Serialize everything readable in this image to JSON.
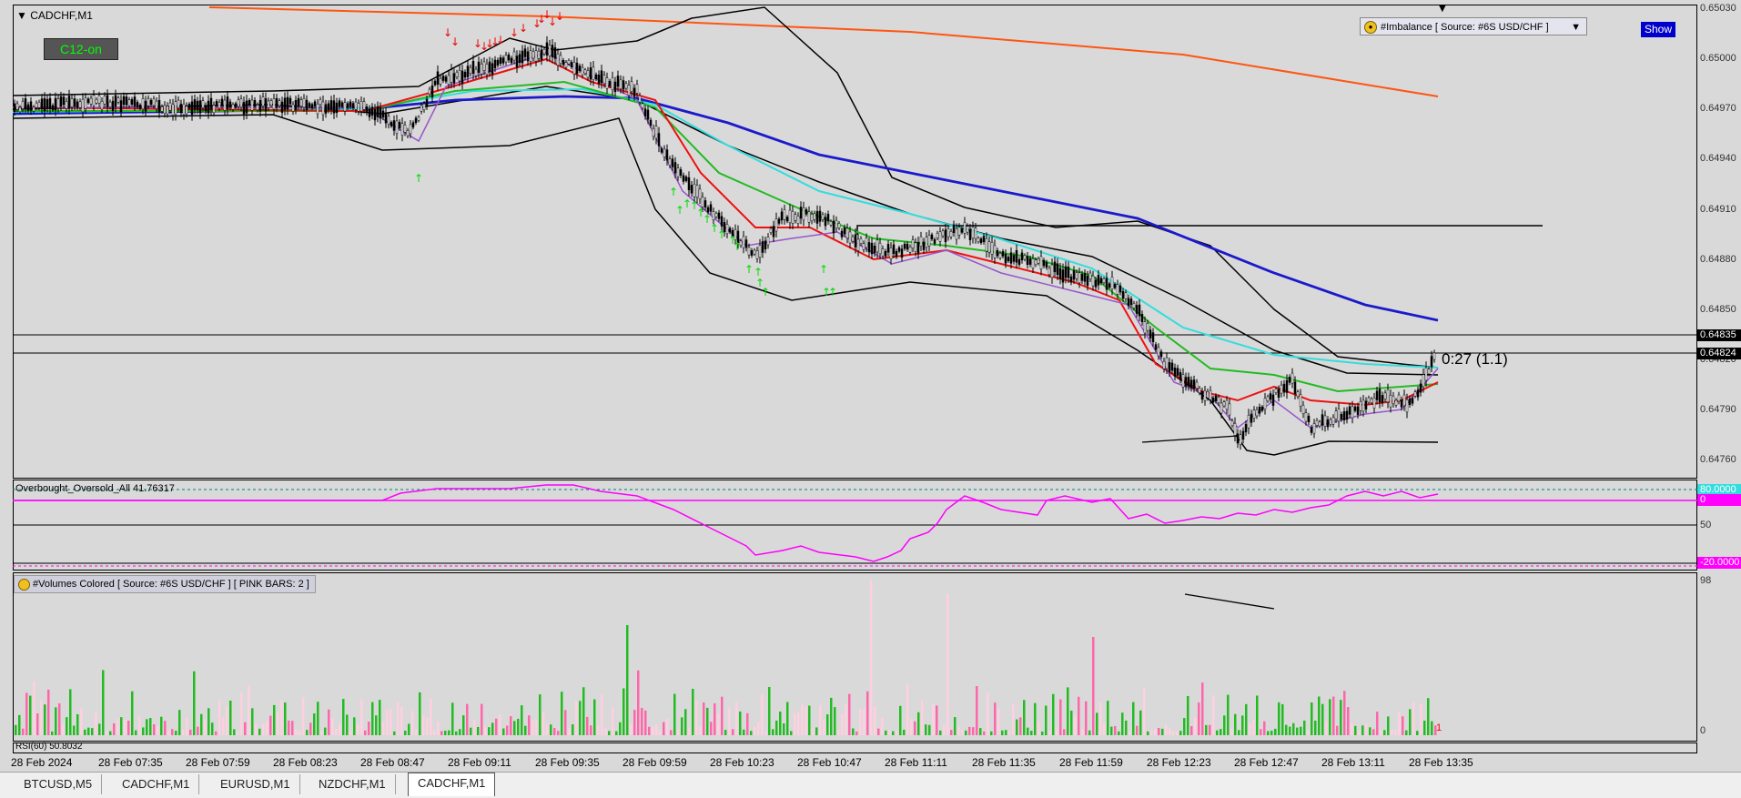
{
  "chart": {
    "title": "CADCHF,M1",
    "c12_label": "C12-on",
    "imbalance_label": "#Imbalance [ Source: #6S USD/CHF ]",
    "show_button": "Show",
    "timer_text": "0:27 (1.1)",
    "oscillator_label": "Overbought_Oversold_All 41.76317",
    "volumes_label": "#Volumes Colored [ Source: #6S USD/CHF ]  [ PINK BARS: 2 ]",
    "rsi_label": "RSI(60) 50.8032",
    "volume_last_count": "1"
  },
  "price_scale": {
    "labels": [
      "0.65030",
      "0.65000",
      "0.64970",
      "0.64940",
      "0.64910",
      "0.64880",
      "0.64850",
      "0.64820",
      "0.64790",
      "0.64760"
    ],
    "tag_upper": "0.64835",
    "tag_lower": "0.64824"
  },
  "osc_scale": {
    "top": "80.0000",
    "pink": "0",
    "mid": "50",
    "bottom": "-20.0000"
  },
  "vol_scale": {
    "top": "98",
    "bottom": "0"
  },
  "time_axis": [
    "28 Feb 2024",
    "28 Feb 07:35",
    "28 Feb 07:59",
    "28 Feb 08:23",
    "28 Feb 08:47",
    "28 Feb 09:11",
    "28 Feb 09:35",
    "28 Feb 09:59",
    "28 Feb 10:23",
    "28 Feb 10:47",
    "28 Feb 11:11",
    "28 Feb 11:35",
    "28 Feb 11:59",
    "28 Feb 12:23",
    "28 Feb 12:47",
    "28 Feb 13:11",
    "28 Feb 13:35"
  ],
  "tabs": [
    {
      "label": "BTCUSD,M5",
      "active": false
    },
    {
      "label": "CADCHF,M1",
      "active": false
    },
    {
      "label": "EURUSD,M1",
      "active": false
    },
    {
      "label": "NZDCHF,M1",
      "active": false
    },
    {
      "label": "CADCHF,M1",
      "active": true
    }
  ],
  "colors": {
    "bull_volume": "#22bb22",
    "bear_volume": "#ffd0e0",
    "pink_volume": "#ff66aa",
    "oscillator": "#ff00ff",
    "ma_blue": "#1a1acc",
    "ma_cyan": "#33dddd",
    "ma_green": "#22bb22",
    "ma_red": "#ee1111",
    "ma_orange": "#ff5511",
    "band_black": "#000000"
  }
}
